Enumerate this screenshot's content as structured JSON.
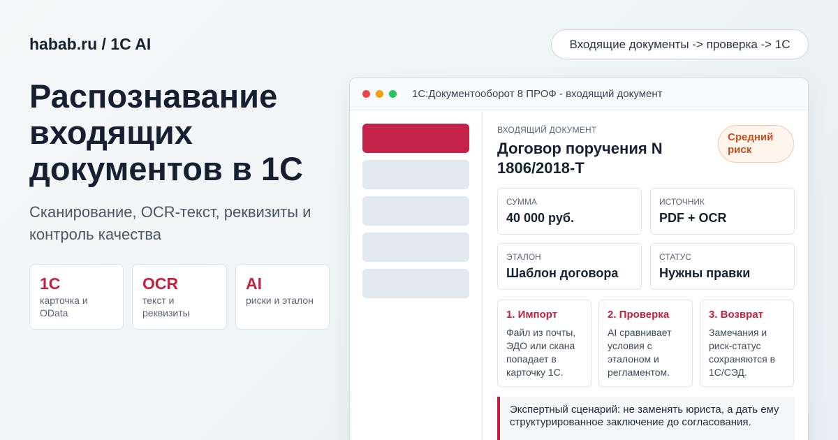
{
  "brand": "habab.ru / 1C AI",
  "flow_pill": "Входящие документы -> проверка -> 1C",
  "headline": "Распознавание входящих документов в 1С",
  "subtitle": "Сканирование, OCR-текст, реквизиты и контроль качества",
  "features": [
    {
      "title": "1C",
      "desc": "карточка и OData"
    },
    {
      "title": "OCR",
      "desc": "текст и реквизиты"
    },
    {
      "title": "AI",
      "desc": "риски и эталон"
    }
  ],
  "window": {
    "title": "1С:Документооборот 8 ПРОФ - входящий документ",
    "doc_kicker": "ВХОДЯЩИЙ ДОКУМЕНТ",
    "doc_title": "Договор поручения N 1806/2018-Т",
    "risk_badge": "Средний риск",
    "info": [
      {
        "label": "СУММА",
        "value": "40 000 руб."
      },
      {
        "label": "ИСТОЧНИК",
        "value": "PDF + OCR"
      },
      {
        "label": "ЭТАЛОН",
        "value": "Шаблон договора"
      },
      {
        "label": "СТАТУС",
        "value": "Нужны правки"
      }
    ],
    "steps": [
      {
        "title": "1. Импорт",
        "desc": "Файл из почты, ЭДО или скана попадает в карточку 1С."
      },
      {
        "title": "2. Проверка",
        "desc": "AI сравнивает условия с эталоном и регламентом."
      },
      {
        "title": "3. Возврат",
        "desc": "Замечания и риск-статус сохраняются в 1С/СЭД."
      }
    ],
    "note": "Экспертный сценарий: не заменять юриста, а дать ему структурированное заключение до согласования."
  },
  "colors": {
    "accent": "#c0223f",
    "risk": "#c5501e"
  }
}
